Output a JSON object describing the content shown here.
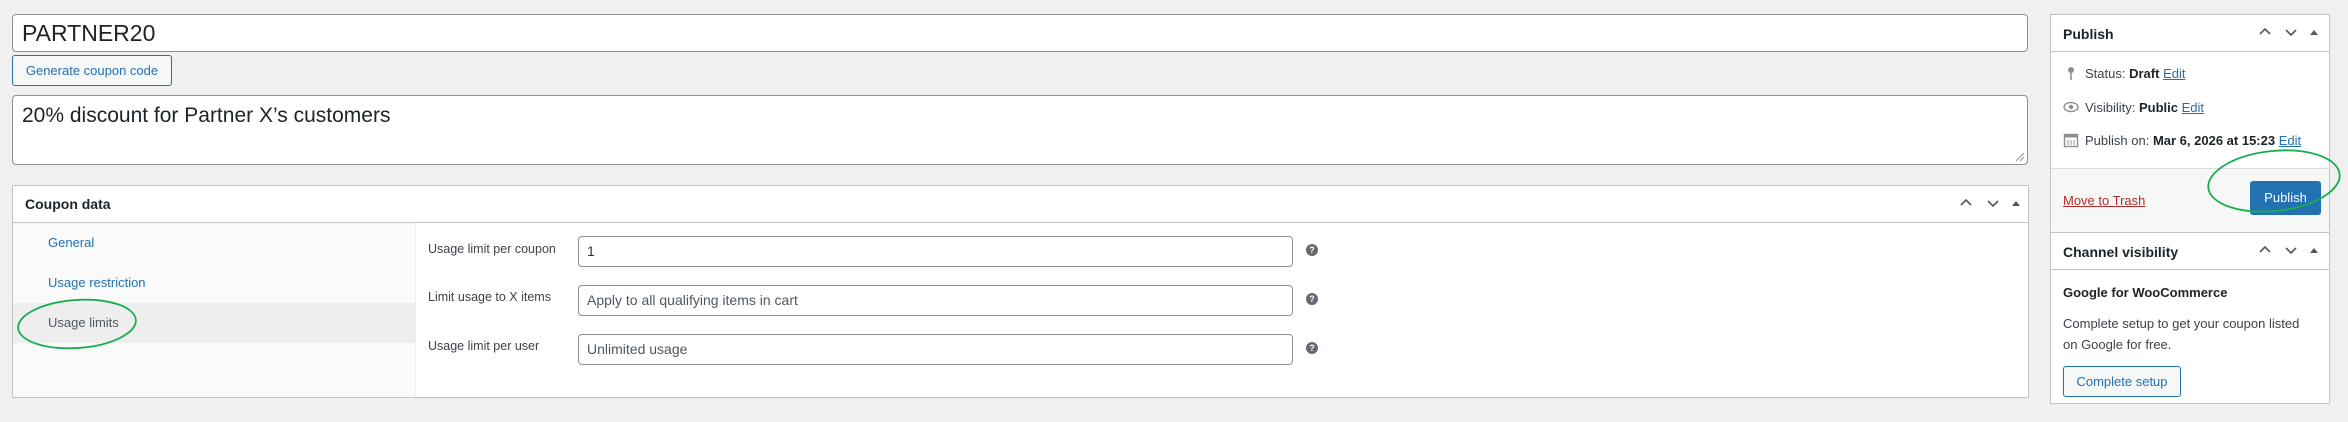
{
  "coupon": {
    "code": "PARTNER20",
    "generate_label": "Generate coupon code",
    "description": "20% discount for Partner X’s customers"
  },
  "coupon_data": {
    "title": "Coupon data",
    "tabs": [
      {
        "label": "General"
      },
      {
        "label": "Usage restriction"
      },
      {
        "label": "Usage limits"
      }
    ],
    "fields": [
      {
        "label": "Usage limit per coupon",
        "value": "1",
        "placeholder": ""
      },
      {
        "label": "Limit usage to X items",
        "value": "",
        "placeholder": "Apply to all qualifying items in cart"
      },
      {
        "label": "Usage limit per user",
        "value": "",
        "placeholder": "Unlimited usage"
      }
    ]
  },
  "publish": {
    "title": "Publish",
    "status_label": "Status:",
    "status_value": "Draft",
    "visibility_label": "Visibility:",
    "visibility_value": "Public",
    "publish_on_label": "Publish on:",
    "publish_on_value": "Mar 6, 2026 at 15:23",
    "edit_label": "Edit",
    "trash_label": "Move to Trash",
    "publish_button": "Publish"
  },
  "channel": {
    "title": "Channel visibility",
    "subtitle": "Google for WooCommerce",
    "text_line1": "Complete setup to get your coupon listed",
    "text_line2": "on Google for free.",
    "button": "Complete setup"
  },
  "colors": {
    "accent": "#2271b1",
    "annotation": "#1aae50",
    "danger": "#b32d2e"
  }
}
